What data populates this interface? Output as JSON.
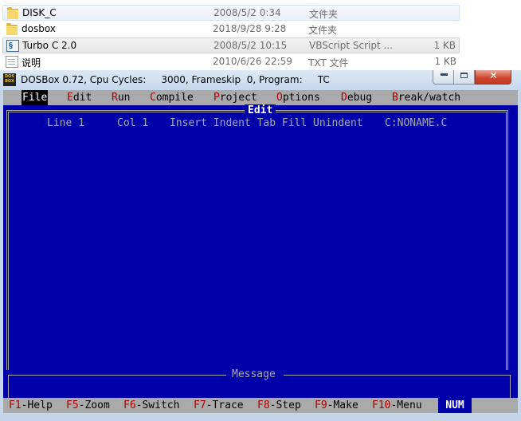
{
  "explorer": {
    "files": [
      {
        "name": "DISK_C",
        "date": "2008/5/2 0:34",
        "type": "文件夹",
        "size": "",
        "icon": "folder-icon"
      },
      {
        "name": "dosbox",
        "date": "2018/9/28 9:28",
        "type": "文件夹",
        "size": "",
        "icon": "folder-icon"
      },
      {
        "name": "Turbo C 2.0",
        "date": "2008/5/2 10:15",
        "type": "VBScript Script ...",
        "size": "1 KB",
        "icon": "vbscript-file-icon"
      },
      {
        "name": "说明",
        "date": "2010/6/26 22:59",
        "type": "TXT 文件",
        "size": "1 KB",
        "icon": "text-file-icon"
      }
    ]
  },
  "dosbox": {
    "icon_text": "DOS BOX",
    "title": "DOSBox 0.72, Cpu Cycles:     3000, Frameskip  0, Program:     TC",
    "close_glyph": "✕"
  },
  "turbo_c": {
    "menu": [
      {
        "hotkey": "F",
        "rest": "ile"
      },
      {
        "hotkey": "E",
        "rest": "dit"
      },
      {
        "hotkey": "R",
        "rest": "un"
      },
      {
        "hotkey": "C",
        "rest": "ompile"
      },
      {
        "hotkey": "P",
        "rest": "roject"
      },
      {
        "hotkey": "O",
        "rest": "ptions"
      },
      {
        "hotkey": "D",
        "rest": "ebug"
      },
      {
        "hotkey": "B",
        "rest": "reak/watch"
      }
    ],
    "edit_title": "Edit",
    "status": {
      "line": "Line 1",
      "col": "Col 1",
      "modes": "Insert Indent Tab Fill Unindent",
      "file": "C:NONAME.C"
    },
    "message_title": "Message",
    "fkeys": [
      {
        "key": "F1",
        "label": "-Help"
      },
      {
        "key": "F5",
        "label": "-Zoom"
      },
      {
        "key": "F6",
        "label": "-Switch"
      },
      {
        "key": "F7",
        "label": "-Trace"
      },
      {
        "key": "F8",
        "label": "-Step"
      },
      {
        "key": "F9",
        "label": "-Make"
      },
      {
        "key": "F10",
        "label": "-Menu"
      }
    ],
    "num_indicator": "NUM"
  }
}
